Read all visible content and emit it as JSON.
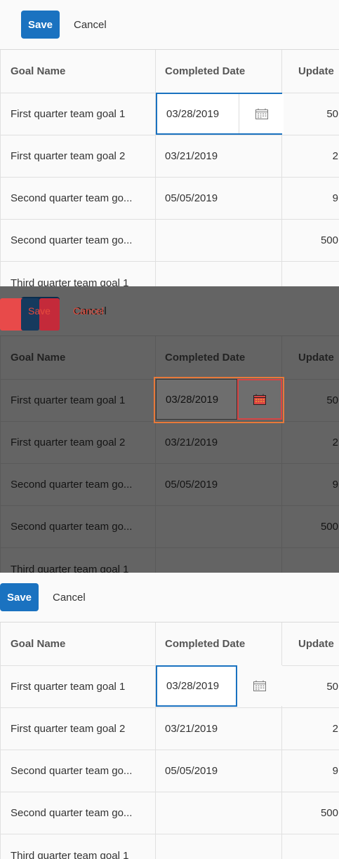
{
  "toolbar": {
    "save_label": "Save",
    "cancel_label": "Cancel"
  },
  "table": {
    "headers": [
      "Goal Name",
      "Completed Date",
      "Update"
    ],
    "rows": [
      {
        "goal": "First quarter team goal 1",
        "date": "03/28/2019",
        "update": "50"
      },
      {
        "goal": "First quarter team goal 2",
        "date": "03/21/2019",
        "update": "2"
      },
      {
        "goal": "Second quarter team go...",
        "date": "05/05/2019",
        "update": "9"
      },
      {
        "goal": "Second quarter team go...",
        "date": "",
        "update": "500"
      },
      {
        "goal": "Third quarter team goal 1",
        "date": "",
        "update": ""
      }
    ]
  },
  "icons": {
    "date_picker": "calendar-icon"
  },
  "colors": {
    "accent": "#1a72c0",
    "highlight": "#d94444",
    "highlight_orange": "#e8793a"
  }
}
